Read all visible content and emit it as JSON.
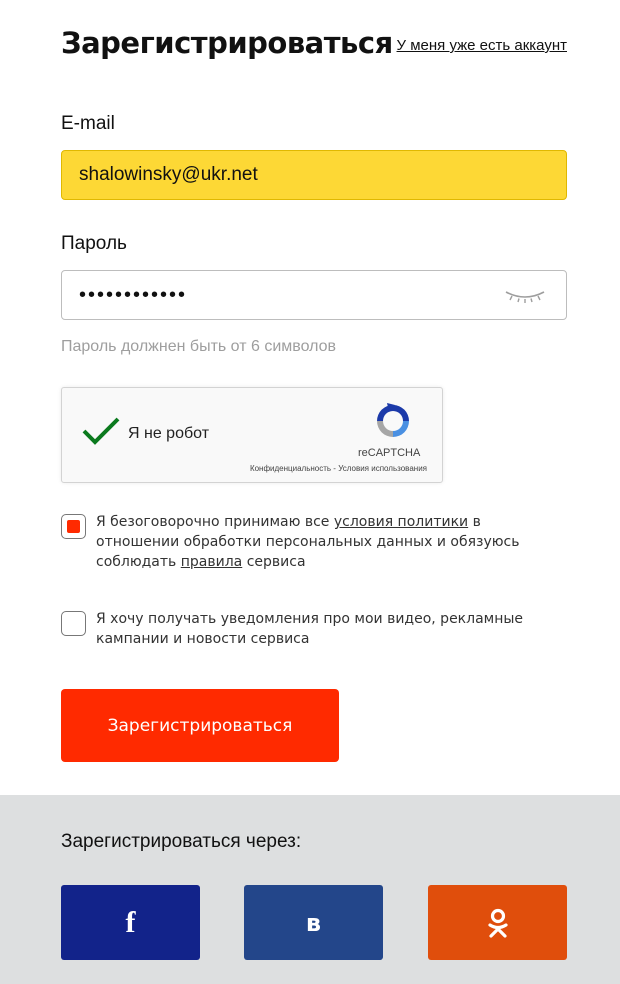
{
  "header": {
    "title": "Зарегистрироваться",
    "login_link": "У меня уже есть аккаунт"
  },
  "form": {
    "email": {
      "label": "E-mail",
      "value": "shalowinsky@ukr.net"
    },
    "password": {
      "label": "Пароль",
      "value": "••••••••••••",
      "hint": "Пароль должнен быть от 6 символов"
    },
    "captcha": {
      "label": "Я не робот",
      "brand": "reCAPTCHA",
      "links": "Конфиденциальность - Условия использования"
    },
    "terms": {
      "checked": true,
      "text_1": "Я безоговорочно принимаю все ",
      "link_1": "условия политики",
      "text_2": " в отношении обработки персональных данных и обязуюсь соблюдать ",
      "link_2": "правила",
      "text_3": " сервиса"
    },
    "notifications": {
      "checked": false,
      "text": "Я хочу получать уведомления про мои видео, рекламные кампании и новости сервиса"
    },
    "submit_label": "Зарегистрироваться"
  },
  "social": {
    "title": "Зарегистрироваться через:",
    "buttons": [
      {
        "icon": "facebook-icon",
        "glyph": "f",
        "color": "#12238a"
      },
      {
        "icon": "vk-icon",
        "glyph": "в",
        "color": "#23468a"
      },
      {
        "icon": "odnoklassniki-icon",
        "glyph": "ok",
        "color": "#e04e0c"
      }
    ]
  },
  "colors": {
    "accent": "#ff2a00",
    "email_fill": "#fdd835",
    "social_bg": "#dddfe0"
  }
}
